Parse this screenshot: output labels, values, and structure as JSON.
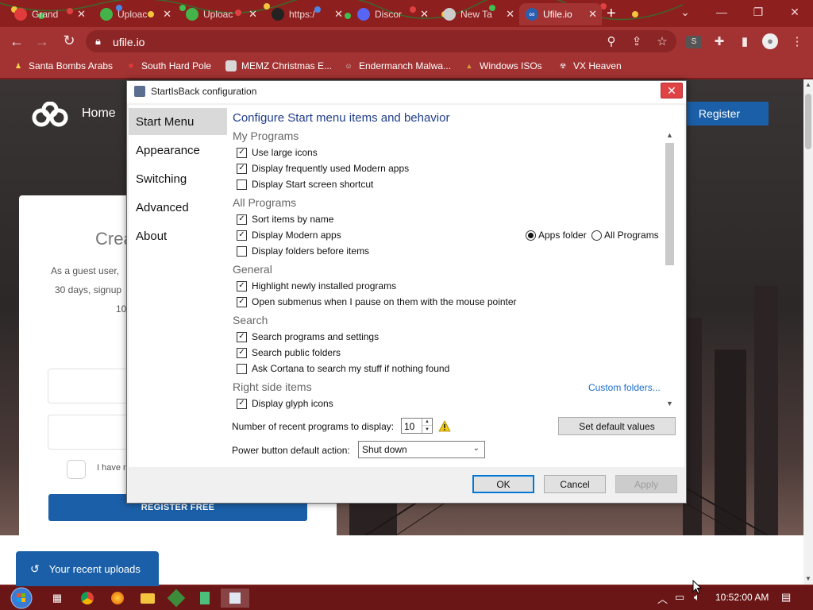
{
  "browser": {
    "tabs": [
      {
        "title": "Grand",
        "fav_color": "#e23b3b"
      },
      {
        "title": "Uploac",
        "fav_color": "#44b44a"
      },
      {
        "title": "Uploac",
        "fav_color": "#44b44a"
      },
      {
        "title": "https:/",
        "fav_color": "#222222"
      },
      {
        "title": "Discor",
        "fav_color": "#5865f2"
      },
      {
        "title": "New Ta",
        "fav_color": "#cccccc"
      },
      {
        "title": "Ufile.io",
        "fav_color": "#ffffff"
      }
    ],
    "url": "ufile.io",
    "profile_letter": "S",
    "bookmarks": [
      {
        "label": "Santa Bombs Arabs",
        "color": "#f2d64b"
      },
      {
        "label": "South Hard Pole",
        "color": "#e23b3b"
      },
      {
        "label": "MEMZ Christmas E...",
        "color": "#d8d8d8"
      },
      {
        "label": "Endermanch Malwa...",
        "color": "#d8d8d8"
      },
      {
        "label": "Windows ISOs",
        "color": "#d4a030"
      },
      {
        "label": "VX Heaven",
        "color": "#e8e8e8"
      }
    ]
  },
  "site": {
    "home": "Home",
    "register": "Register",
    "card_title": "Crea",
    "line1": "As a guest user,",
    "line2": "30 days, signup",
    "line3": "10",
    "checkbox_text": "I have r",
    "submit": "REGISTER FREE",
    "recent_uploads": "Your recent uploads"
  },
  "dialog": {
    "title": "StartIsBack configuration",
    "nav": [
      "Start Menu",
      "Appearance",
      "Switching",
      "Advanced",
      "About"
    ],
    "selected_nav": 0,
    "heading": "Configure Start menu items and behavior",
    "sections": {
      "my_programs": "My Programs",
      "all_programs": "All Programs",
      "general": "General",
      "search": "Search",
      "right_side": "Right side items"
    },
    "options": [
      {
        "label": "Use large icons",
        "checked": true
      },
      {
        "label": "Display frequently used Modern apps",
        "checked": true
      },
      {
        "label": "Display Start screen shortcut",
        "checked": false
      },
      {
        "label": "Sort items by name",
        "checked": true
      },
      {
        "label": "Display Modern apps",
        "checked": true
      },
      {
        "label": "Display folders before items",
        "checked": false
      },
      {
        "label": "Highlight newly installed programs",
        "checked": true
      },
      {
        "label": "Open submenus when I pause on them with the mouse pointer",
        "checked": true
      },
      {
        "label": "Search programs and settings",
        "checked": true
      },
      {
        "label": "Search public folders",
        "checked": true
      },
      {
        "label": "Ask Cortana to search my stuff if nothing found",
        "checked": false
      },
      {
        "label": "Display glyph icons",
        "checked": true
      }
    ],
    "radios": [
      {
        "label": "Apps folder",
        "selected": true
      },
      {
        "label": "All Programs",
        "selected": false
      }
    ],
    "custom_folders": "Custom folders...",
    "recent_label": "Number of recent programs to display:",
    "recent_value": "10",
    "set_default": "Set default values",
    "power_label": "Power button default action:",
    "power_value": "Shut down",
    "buttons": {
      "ok": "OK",
      "cancel": "Cancel",
      "apply": "Apply"
    }
  },
  "taskbar": {
    "clock": "10:52:00 AM"
  },
  "colors": {
    "accent": "#1b5fa8",
    "heading": "#1f3d8a",
    "link": "#1c6ec9",
    "browser_frame": "#a33333"
  }
}
